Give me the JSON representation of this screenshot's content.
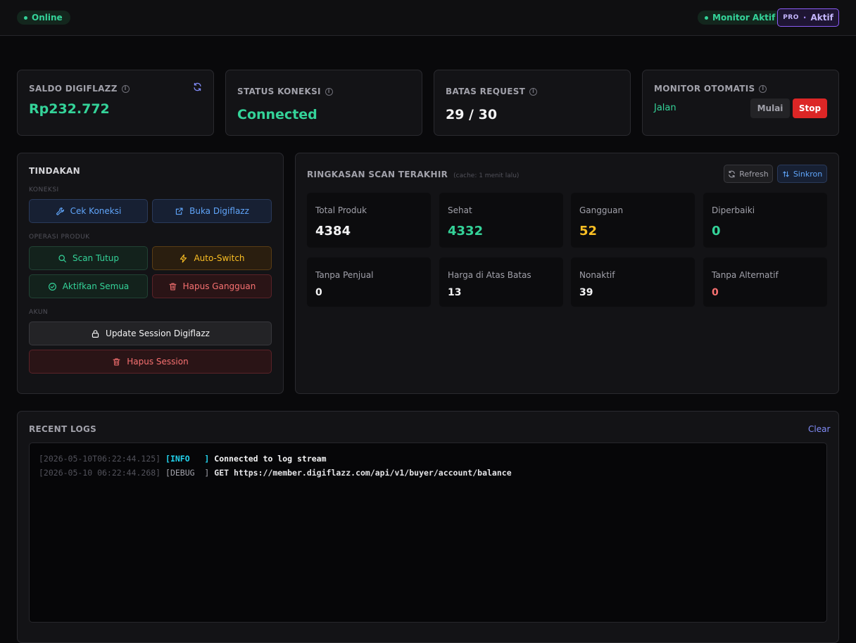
{
  "topbar": {
    "online_label": "Online",
    "monitor_label": "Monitor Aktif",
    "plan_label": "PRO",
    "plan_sep": "·",
    "plan_status": "Aktif"
  },
  "stats": {
    "saldo": {
      "title": "SALDO DIGIFLAZZ",
      "value": "Rp232.772"
    },
    "koneksi": {
      "title": "STATUS KONEKSI",
      "value": "Connected"
    },
    "batas": {
      "title": "BATAS REQUEST",
      "value": "29 / 30"
    },
    "monitor": {
      "title": "MONITOR OTOMATIS",
      "state": "Jalan",
      "start_label": "Mulai",
      "stop_label": "Stop"
    }
  },
  "actions": {
    "title": "TINDAKAN",
    "section_koneksi": "KONEKSI",
    "cek_koneksi": "Cek Koneksi",
    "buka_digiflazz": "Buka Digiflazz",
    "section_operasi": "OPERASI PRODUK",
    "scan_tutup": "Scan Tutup",
    "auto_switch": "Auto-Switch",
    "aktifkan_semua": "Aktifkan Semua",
    "hapus_gangguan": "Hapus Gangguan",
    "section_akun": "AKUN",
    "update_session": "Update Session Digiflazz",
    "hapus_session": "Hapus Session"
  },
  "scan": {
    "title": "RINGKASAN SCAN TERAKHIR",
    "cache_note": "(cache: 1 menit lalu)",
    "refresh_label": "Refresh",
    "sync_label": "Sinkron",
    "metrics": [
      {
        "label": "Total Produk",
        "value": "4384",
        "color": "#f4f4f5"
      },
      {
        "label": "Sehat",
        "value": "4332",
        "color": "#34d399"
      },
      {
        "label": "Gangguan",
        "value": "52",
        "color": "#fbbf24"
      },
      {
        "label": "Diperbaiki",
        "value": "0",
        "color": "#34d399"
      },
      {
        "label": "Tanpa Penjual",
        "value": "0",
        "color": "#f4f4f5"
      },
      {
        "label": "Harga di Atas Batas",
        "value": "13",
        "color": "#f4f4f5"
      },
      {
        "label": "Nonaktif",
        "value": "39",
        "color": "#f4f4f5"
      },
      {
        "label": "Tanpa Alternatif",
        "value": "0",
        "color": "#f87171"
      }
    ]
  },
  "logs": {
    "title": "RECENT LOGS",
    "clear_label": "Clear",
    "entries": [
      {
        "ts": "[2026-05-10T06:22:44.125]",
        "level": "[INFO   ]",
        "msg": "Connected to log stream"
      },
      {
        "ts": "[2026-05-10 06:22:44.268]",
        "level": "[DEBUG  ]",
        "msg": "GET https://member.digiflazz.com/api/v1/buyer/account/balance"
      }
    ]
  }
}
